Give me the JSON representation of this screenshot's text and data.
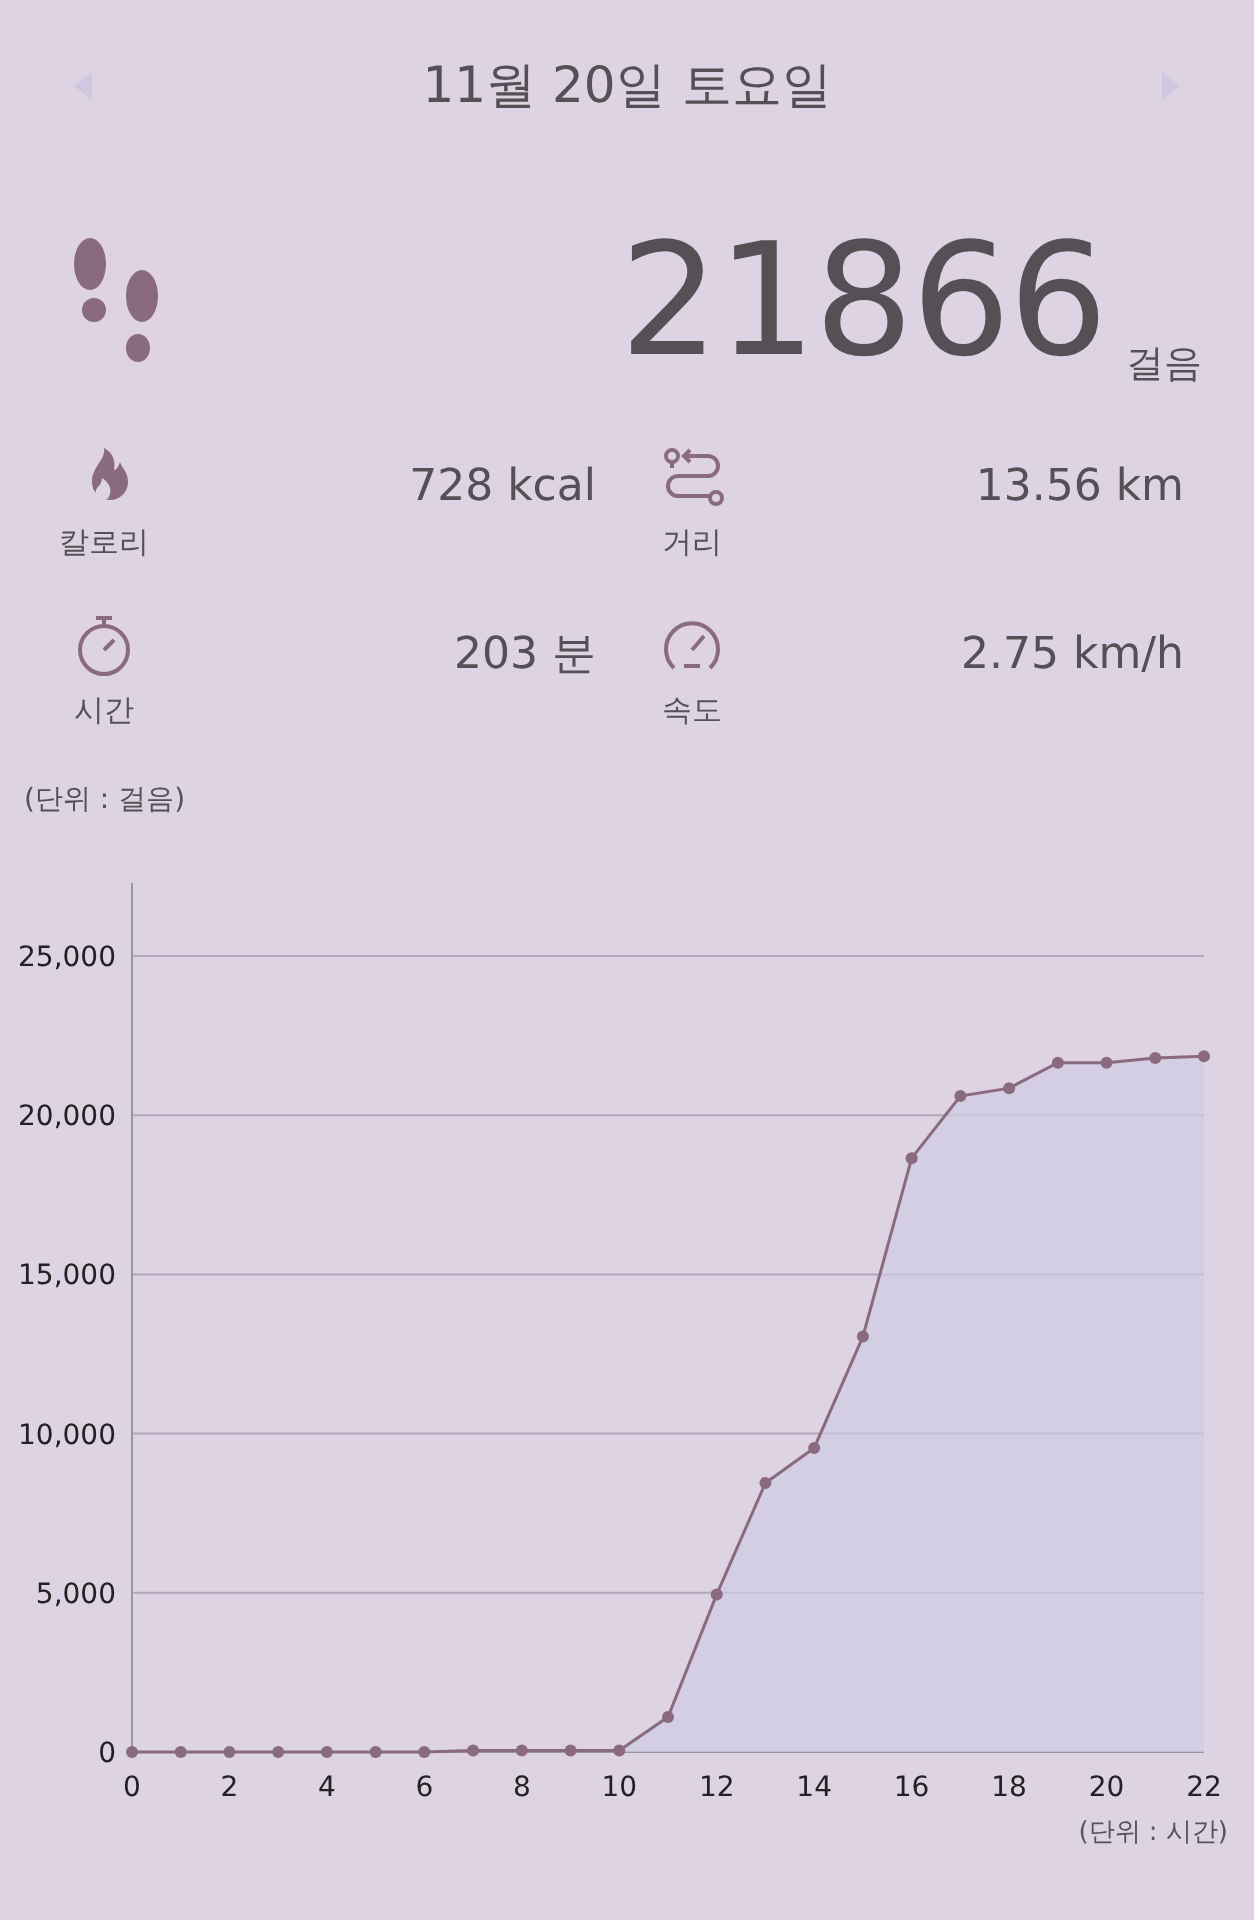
{
  "header": {
    "prev": {
      "disabled": true
    },
    "title": "11월 20일 토요일",
    "next": {
      "disabled": true
    }
  },
  "steps": {
    "value": "21866",
    "unit": "걸음"
  },
  "stats": [
    {
      "kind": "calories",
      "label": "칼로리",
      "value": "728 kcal"
    },
    {
      "kind": "distance",
      "label": "거리",
      "value": "13.56 km"
    },
    {
      "kind": "time",
      "label": "시간",
      "value": "203 분"
    },
    {
      "kind": "speed",
      "label": "속도",
      "value": "2.75 km/h"
    }
  ],
  "chart": {
    "unit_label": "(단위 : 걸음)",
    "x_unit_label": "(단위 : 시간)",
    "chart_data": {
      "type": "area",
      "x": [
        0,
        1,
        2,
        3,
        4,
        5,
        6,
        7,
        8,
        9,
        10,
        11,
        12,
        13,
        14,
        15,
        16,
        17,
        18,
        19,
        20,
        21,
        22
      ],
      "series": [
        {
          "color": "#8a6a7e",
          "values": [
            0,
            0,
            0,
            0,
            0,
            0,
            0,
            50,
            50,
            50,
            50,
            1100,
            4950,
            8450,
            9550,
            13050,
            18650,
            20600,
            20850,
            21650,
            21650,
            21800,
            21850
          ]
        }
      ],
      "grid": true,
      "xlim": [
        0,
        22
      ],
      "ylim": [
        0,
        27300
      ],
      "xticks": [
        0,
        2,
        4,
        6,
        8,
        10,
        12,
        14,
        16,
        18,
        20,
        22
      ],
      "yticks": [
        {
          "value": 0,
          "label": "0"
        },
        {
          "value": 5000,
          "label": "5,000"
        },
        {
          "value": 10000,
          "label": "10,000"
        },
        {
          "value": 15000,
          "label": "15,000"
        },
        {
          "value": 20000,
          "label": "20,000"
        },
        {
          "value": 25000,
          "label": "25,000"
        }
      ]
    }
  }
}
